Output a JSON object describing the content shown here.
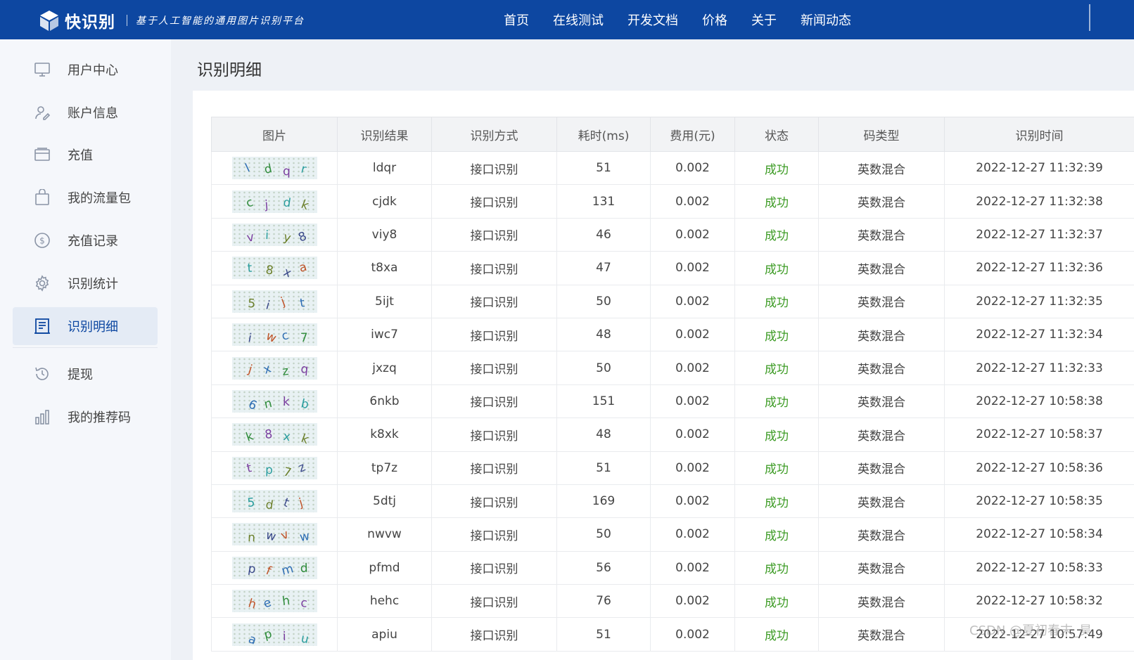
{
  "header": {
    "logo_text": "快识别",
    "slogan": "基于人工智能的通用图片识别平台",
    "nav": [
      "首页",
      "在线测试",
      "开发文档",
      "价格",
      "关于",
      "新闻动态"
    ]
  },
  "sidebar": {
    "items": [
      {
        "label": "用户中心",
        "icon": "monitor-icon"
      },
      {
        "label": "账户信息",
        "icon": "user-edit-icon"
      },
      {
        "label": "充值",
        "icon": "wallet-icon"
      },
      {
        "label": "我的流量包",
        "icon": "bag-icon"
      },
      {
        "label": "充值记录",
        "icon": "dollar-circle-icon"
      },
      {
        "label": "识别统计",
        "icon": "gear-icon"
      },
      {
        "label": "识别明细",
        "icon": "receipt-icon",
        "active": true
      },
      {
        "label": "提现",
        "icon": "clock-icon"
      },
      {
        "label": "我的推荐码",
        "icon": "bar-chart-icon"
      }
    ]
  },
  "page_title": "识别明细",
  "table": {
    "headers": [
      "图片",
      "识别结果",
      "识别方式",
      "耗时(ms)",
      "费用(元)",
      "状态",
      "码类型",
      "识别时间"
    ],
    "rows": [
      {
        "result": "ldqr",
        "method": "接口识别",
        "ms": "51",
        "fee": "0.002",
        "status": "成功",
        "type": "英数混合",
        "time": "2022-12-27 11:32:39"
      },
      {
        "result": "cjdk",
        "method": "接口识别",
        "ms": "131",
        "fee": "0.002",
        "status": "成功",
        "type": "英数混合",
        "time": "2022-12-27 11:32:38"
      },
      {
        "result": "viy8",
        "method": "接口识别",
        "ms": "46",
        "fee": "0.002",
        "status": "成功",
        "type": "英数混合",
        "time": "2022-12-27 11:32:37"
      },
      {
        "result": "t8xa",
        "method": "接口识别",
        "ms": "47",
        "fee": "0.002",
        "status": "成功",
        "type": "英数混合",
        "time": "2022-12-27 11:32:36"
      },
      {
        "result": "5ijt",
        "method": "接口识别",
        "ms": "50",
        "fee": "0.002",
        "status": "成功",
        "type": "英数混合",
        "time": "2022-12-27 11:32:35"
      },
      {
        "result": "iwc7",
        "method": "接口识别",
        "ms": "48",
        "fee": "0.002",
        "status": "成功",
        "type": "英数混合",
        "time": "2022-12-27 11:32:34"
      },
      {
        "result": "jxzq",
        "method": "接口识别",
        "ms": "50",
        "fee": "0.002",
        "status": "成功",
        "type": "英数混合",
        "time": "2022-12-27 11:32:33"
      },
      {
        "result": "6nkb",
        "method": "接口识别",
        "ms": "151",
        "fee": "0.002",
        "status": "成功",
        "type": "英数混合",
        "time": "2022-12-27 10:58:38"
      },
      {
        "result": "k8xk",
        "method": "接口识别",
        "ms": "48",
        "fee": "0.002",
        "status": "成功",
        "type": "英数混合",
        "time": "2022-12-27 10:58:37"
      },
      {
        "result": "tp7z",
        "method": "接口识别",
        "ms": "51",
        "fee": "0.002",
        "status": "成功",
        "type": "英数混合",
        "time": "2022-12-27 10:58:36"
      },
      {
        "result": "5dtj",
        "method": "接口识别",
        "ms": "169",
        "fee": "0.002",
        "status": "成功",
        "type": "英数混合",
        "time": "2022-12-27 10:58:35"
      },
      {
        "result": "nwvw",
        "method": "接口识别",
        "ms": "50",
        "fee": "0.002",
        "status": "成功",
        "type": "英数混合",
        "time": "2022-12-27 10:58:34"
      },
      {
        "result": "pfmd",
        "method": "接口识别",
        "ms": "56",
        "fee": "0.002",
        "status": "成功",
        "type": "英数混合",
        "time": "2022-12-27 10:58:33"
      },
      {
        "result": "hehc",
        "method": "接口识别",
        "ms": "76",
        "fee": "0.002",
        "status": "成功",
        "type": "英数混合",
        "time": "2022-12-27 10:58:32"
      },
      {
        "result": "apiu",
        "method": "接口识别",
        "ms": "51",
        "fee": "0.002",
        "status": "成功",
        "type": "英数混合",
        "time": "2022-12-27 10:57:49"
      }
    ]
  },
  "watermark": "CSDN @夏初春末_昊",
  "colors": {
    "header_bg": "#0d47a1",
    "success": "#3c9b24",
    "active_bg": "#e4ebf5"
  }
}
